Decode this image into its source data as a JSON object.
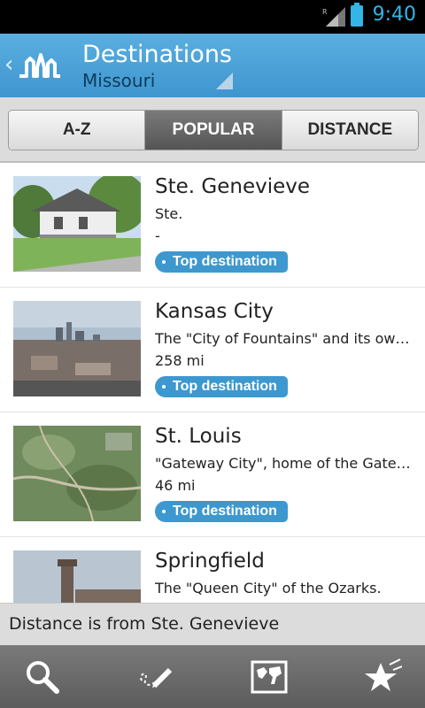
{
  "status": {
    "time": "9:40",
    "roaming": "R"
  },
  "header": {
    "title": "Destinations",
    "subtitle": "Missouri"
  },
  "tabs": [
    {
      "label": "A-Z",
      "active": false
    },
    {
      "label": "POPULAR",
      "active": true
    },
    {
      "label": "DISTANCE",
      "active": false
    }
  ],
  "destinations": [
    {
      "name": "Ste. Genevieve",
      "desc": "Ste.",
      "distance": "-",
      "badge": "Top destination"
    },
    {
      "name": "Kansas City",
      "desc": "The \"City of Fountains\" and its own...",
      "distance": "258 mi",
      "badge": "Top destination"
    },
    {
      "name": "St. Louis",
      "desc": "\"Gateway City\", home of the Gatew...",
      "distance": "46 mi",
      "badge": "Top destination"
    },
    {
      "name": "Springfield",
      "desc": "The \"Queen City\" of the Ozarks.",
      "distance": "",
      "badge": ""
    }
  ],
  "footnote": "Distance is from Ste. Genevieve",
  "bottom_nav": [
    "search-icon",
    "draw-icon",
    "map-icon",
    "stars-icon"
  ],
  "colors": {
    "accent": "#33b5e5",
    "header": "#4a9fd6",
    "badge": "#3d98cf"
  }
}
